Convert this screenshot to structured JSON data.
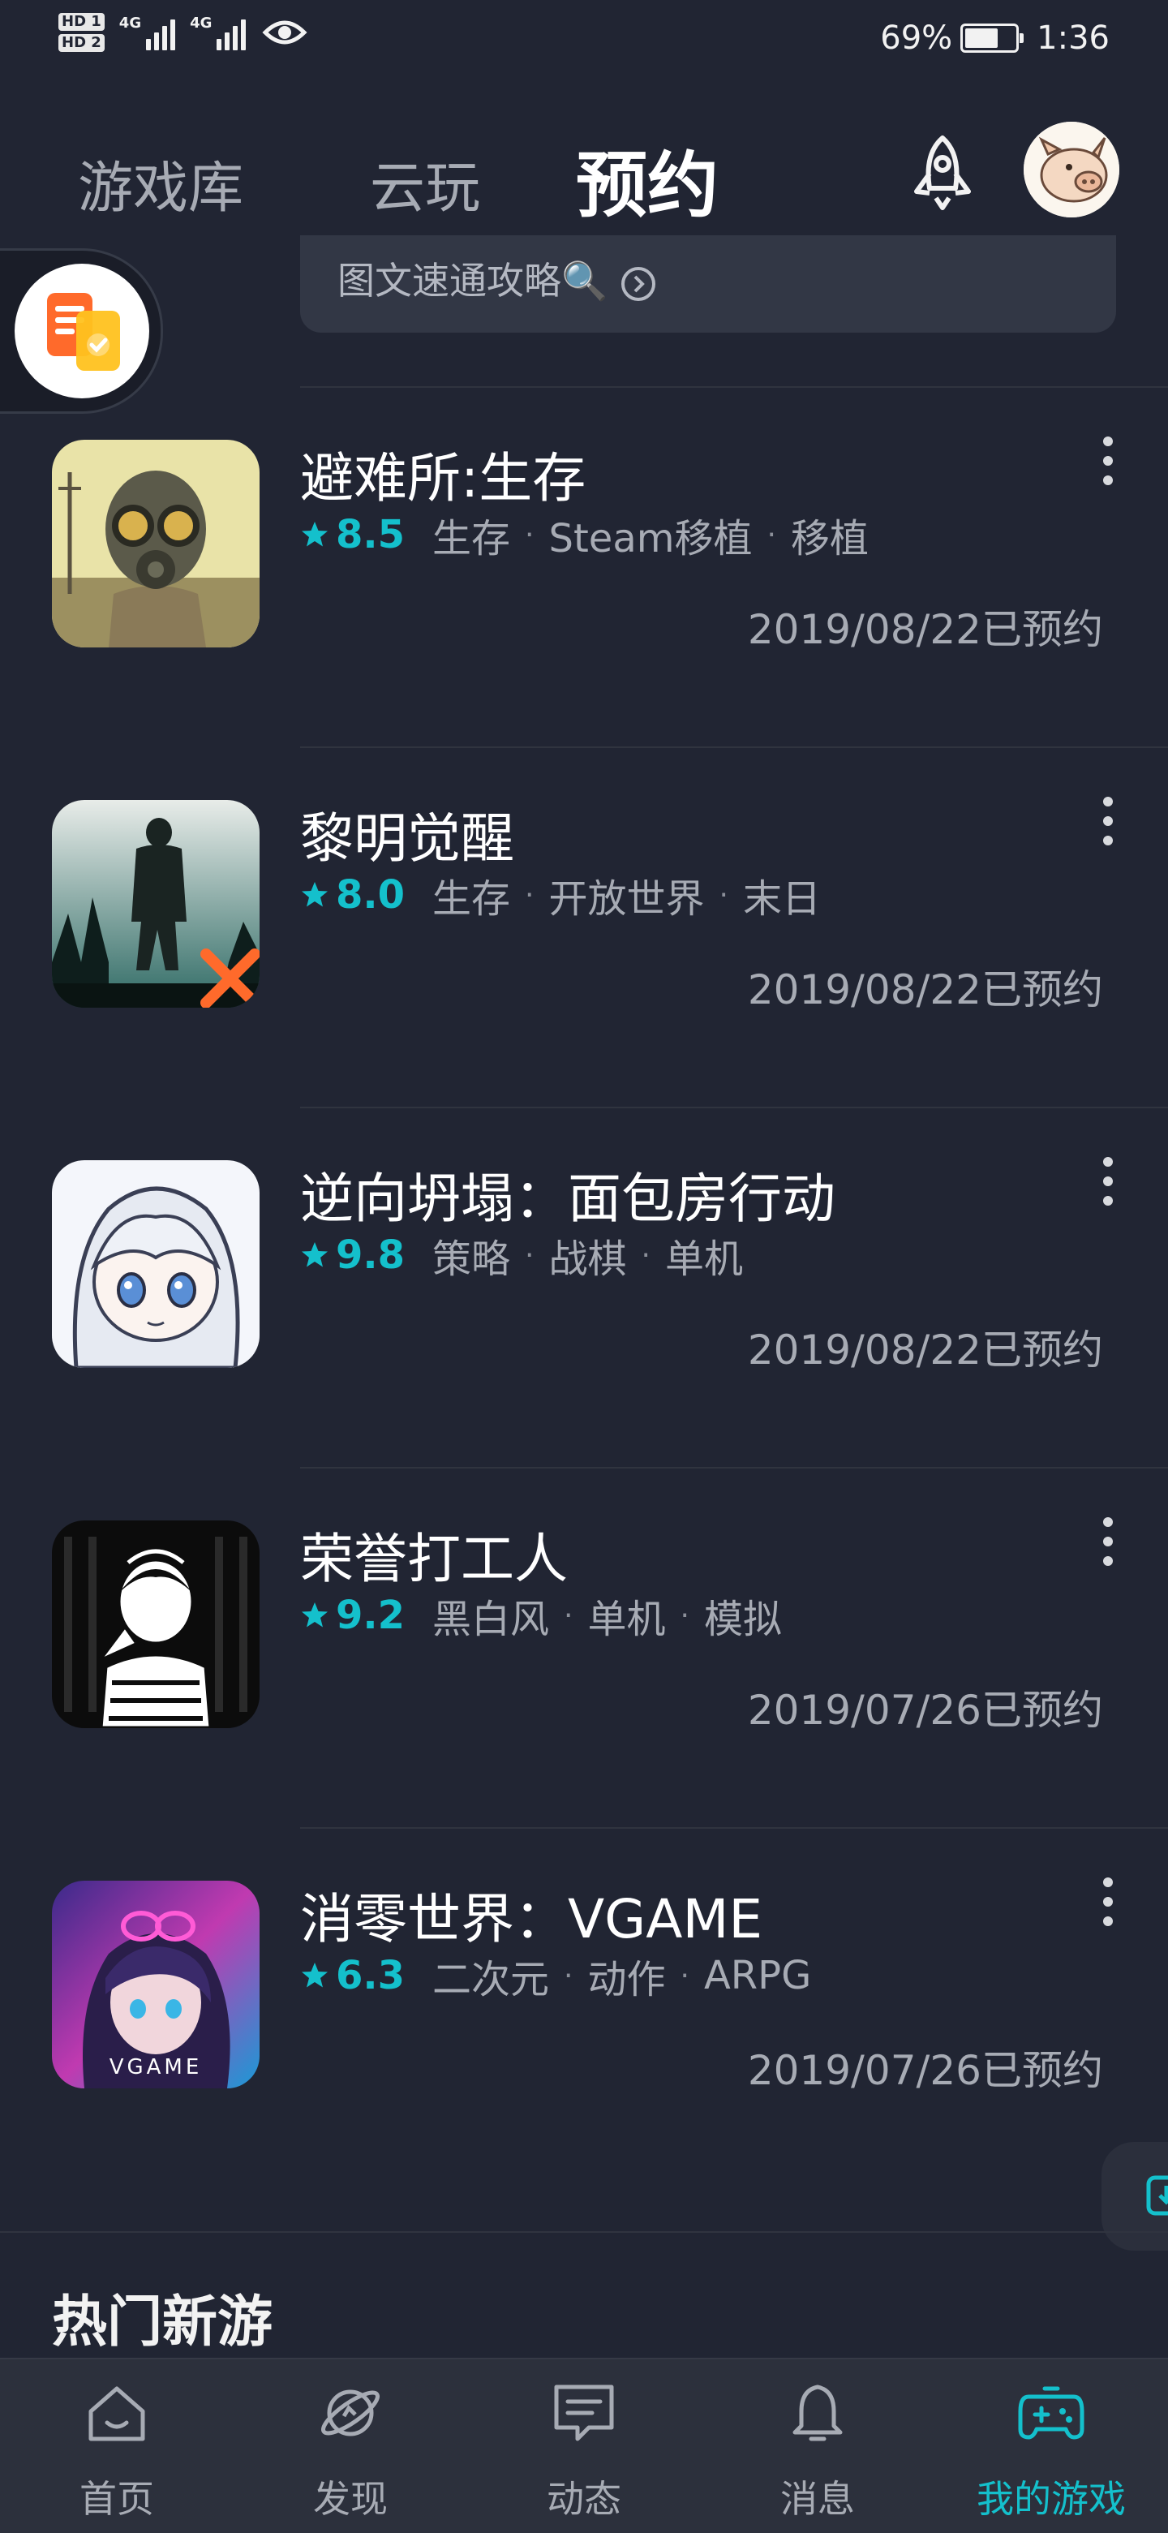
{
  "status_bar": {
    "network_label_1": "4G",
    "network_label_2": "4G",
    "hd_1": "HD 1",
    "hd_2": "HD 2",
    "battery_level": 0.69,
    "battery_text": "69%",
    "time": "1:36"
  },
  "top_tabs": [
    {
      "label": "游戏库",
      "active": false
    },
    {
      "label": "云玩",
      "active": false
    },
    {
      "label": "预约",
      "active": true
    }
  ],
  "banner": {
    "text": "图文速通攻略🔍"
  },
  "games": [
    {
      "title": "避难所:生存",
      "rating": "8.5",
      "tags": [
        "生存",
        "Steam移植",
        "移植"
      ],
      "reserve_date": "2019/08/22已预约"
    },
    {
      "title": "黎明觉醒",
      "rating": "8.0",
      "tags": [
        "生存",
        "开放世界",
        "末日"
      ],
      "reserve_date": "2019/08/22已预约"
    },
    {
      "title": "逆向坍塌：面包房行动",
      "rating": "9.8",
      "tags": [
        "策略",
        "战棋",
        "单机"
      ],
      "reserve_date": "2019/08/22已预约"
    },
    {
      "title": "荣誉打工人",
      "rating": "9.2",
      "tags": [
        "黑白风",
        "单机",
        "模拟"
      ],
      "reserve_date": "2019/07/26已预约"
    },
    {
      "title": "消零世界：VGAME",
      "rating": "6.3",
      "tags": [
        "二次元",
        "动作",
        "ARPG"
      ],
      "reserve_date": "2019/07/26已预约"
    }
  ],
  "game_icon_texts": {
    "vgame": "VGAME"
  },
  "section": {
    "title": "热门新游"
  },
  "bottom_nav": [
    {
      "label": "首页",
      "icon": "home-icon",
      "active": false
    },
    {
      "label": "发现",
      "icon": "planet-icon",
      "active": false
    },
    {
      "label": "动态",
      "icon": "chat-icon",
      "active": false
    },
    {
      "label": "消息",
      "icon": "bell-icon",
      "active": false
    },
    {
      "label": "我的游戏",
      "icon": "gamepad-icon",
      "active": true
    }
  ],
  "colors": {
    "background": "#212533",
    "accent": "#14c0cc",
    "nav_background": "#2c303c"
  }
}
